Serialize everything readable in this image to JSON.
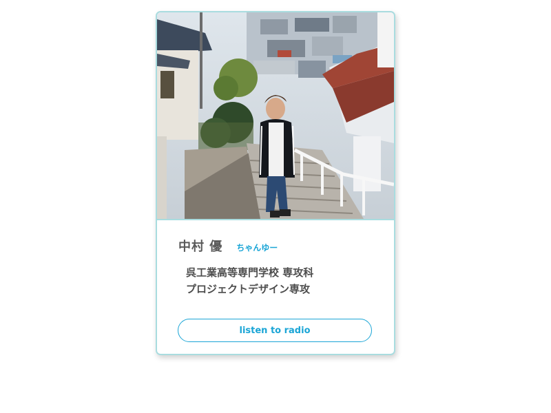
{
  "profile": {
    "name": "中村 優",
    "nickname": "ちゃんゆー",
    "affiliation_line1": "呉工業高等専門学校 専攻科",
    "affiliation_line2": "プロジェクトデザイン専攻",
    "photo_icon": "profile-photo",
    "button_label": "listen to radio"
  },
  "colors": {
    "accent": "#1aa5d6",
    "card_border": "#a9dcdf",
    "text": "#4d4d4d"
  }
}
